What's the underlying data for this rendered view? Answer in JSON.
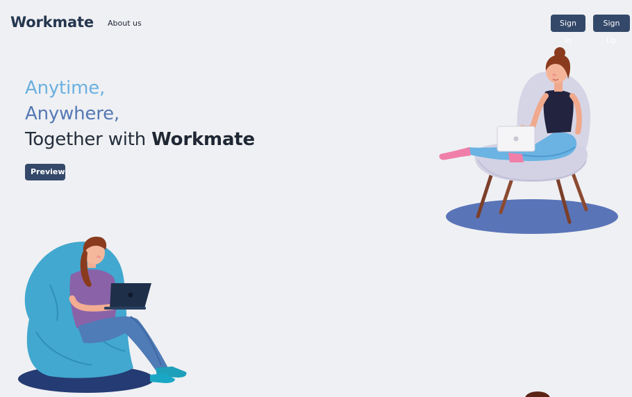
{
  "nav": {
    "brand": "Workmate",
    "about_label": "About us",
    "signin_label": "Sign In",
    "signup_label": "Sign Up"
  },
  "hero": {
    "line1": "Anytime,",
    "line2": "Anywhere,",
    "line3_prefix": "Together with ",
    "line3_brand": "Workmate",
    "preview_label": "Preview"
  },
  "illustrations": {
    "chair_woman": "woman-laptop-armchair-illustration",
    "beanbag_woman": "woman-laptop-beanbag-illustration"
  },
  "colors": {
    "background": "#eff0f3",
    "brand_text": "#25364f",
    "button_bg": "#34496a",
    "accent_light_blue": "#6ab0e0",
    "accent_blue": "#5478b5"
  }
}
